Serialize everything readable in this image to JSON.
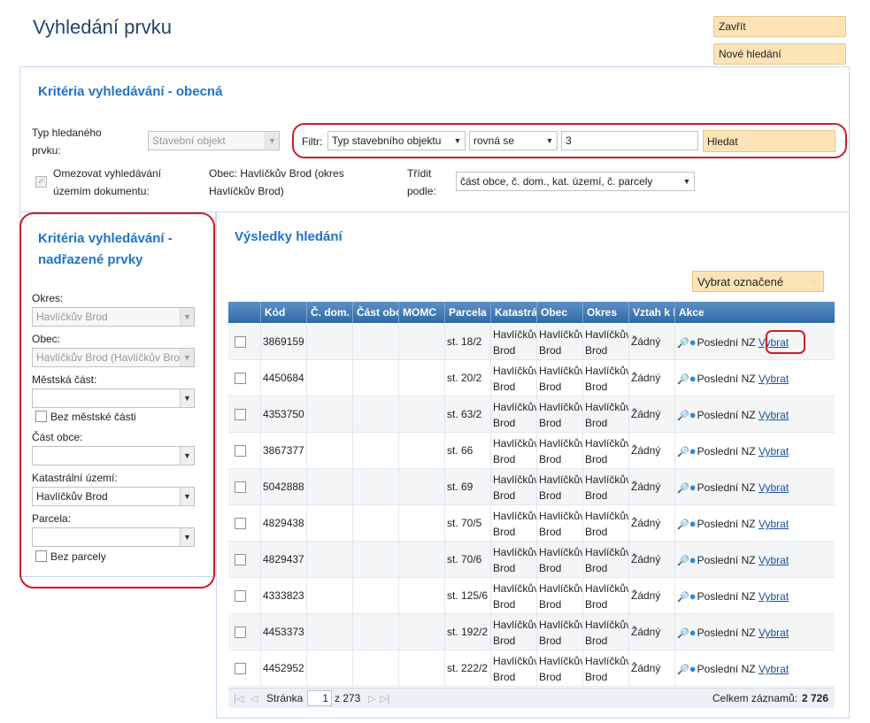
{
  "page_title": "Vyhledání prvku",
  "buttons": {
    "close": "Zavřít",
    "new_search": "Nové hledání",
    "search": "Hledat",
    "select_marked": "Vybrat označené"
  },
  "general": {
    "title": "Kritéria vyhledávání - obecná",
    "type_label": "Typ hledaného prvku:",
    "type_value": "Stavební objekt",
    "filter_label": "Filtr:",
    "filter_field": "Typ stavebního objektu",
    "filter_operator": "rovná se",
    "filter_value": "3",
    "restrict_label": "Omezovat vyhledávání územím dokumentu:",
    "obec_info": "Obec: Havlíčkův Brod (okres Havlíčkův Brod)",
    "sort_label": "Třídit podle:",
    "sort_value": "část obce, č. dom., kat. území, č. parcely"
  },
  "parent": {
    "title": "Kritéria vyhledávání - nadřazené prvky",
    "okres_label": "Okres:",
    "okres_value": "Havlíčkův Brod",
    "obec_label": "Obec:",
    "obec_value": "Havlíčkův Brod (Havlíčkův Brod)",
    "mestska_cast_label": "Městská část:",
    "mestska_cast_value": "",
    "bez_mestske_casti": "Bez městské části",
    "cast_obce_label": "Část obce:",
    "cast_obce_value": "",
    "katastralni_label": "Katastrální území:",
    "katastralni_value": "Havlíčkův Brod",
    "parcela_label": "Parcela:",
    "parcela_value": "",
    "bez_parcely": "Bez parcely"
  },
  "results": {
    "title": "Výsledky hledání",
    "columns": [
      "Kód",
      "Č. dom.",
      "Část obce",
      "MOMC",
      "Parcela",
      "Katastrální území",
      "Obec",
      "Okres",
      "Vztah k NZ",
      "Akce"
    ],
    "rows": [
      {
        "kod": "3869159",
        "parcela": "st. 18/2",
        "ku_1": "Havlíčkův",
        "ku_2": "Brod",
        "obec_1": "Havlíčkův",
        "obec_2": "Brod",
        "okres_1": "Havlíčkův",
        "okres_2": "Brod",
        "vztah": "Žádný",
        "nz": "Poslední NZ",
        "action": "Vybrat"
      },
      {
        "kod": "4450684",
        "parcela": "st. 20/2",
        "ku_1": "Havlíčkův",
        "ku_2": "Brod",
        "obec_1": "Havlíčkův",
        "obec_2": "Brod",
        "okres_1": "Havlíčkův",
        "okres_2": "Brod",
        "vztah": "Žádný",
        "nz": "Poslední NZ",
        "action": "Vybrat"
      },
      {
        "kod": "4353750",
        "parcela": "st. 63/2",
        "ku_1": "Havlíčkův",
        "ku_2": "Brod",
        "obec_1": "Havlíčkův",
        "obec_2": "Brod",
        "okres_1": "Havlíčkův",
        "okres_2": "Brod",
        "vztah": "Žádný",
        "nz": "Poslední NZ",
        "action": "Vybrat"
      },
      {
        "kod": "3867377",
        "parcela": "st. 66",
        "ku_1": "Havlíčkův",
        "ku_2": "Brod",
        "obec_1": "Havlíčkův",
        "obec_2": "Brod",
        "okres_1": "Havlíčkův",
        "okres_2": "Brod",
        "vztah": "Žádný",
        "nz": "Poslední NZ",
        "action": "Vybrat"
      },
      {
        "kod": "5042888",
        "parcela": "st. 69",
        "ku_1": "Havlíčkův",
        "ku_2": "Brod",
        "obec_1": "Havlíčkův",
        "obec_2": "Brod",
        "okres_1": "Havlíčkův",
        "okres_2": "Brod",
        "vztah": "Žádný",
        "nz": "Poslední NZ",
        "action": "Vybrat"
      },
      {
        "kod": "4829438",
        "parcela": "st. 70/5",
        "ku_1": "Havlíčkův",
        "ku_2": "Brod",
        "obec_1": "Havlíčkův",
        "obec_2": "Brod",
        "okres_1": "Havlíčkův",
        "okres_2": "Brod",
        "vztah": "Žádný",
        "nz": "Poslední NZ",
        "action": "Vybrat"
      },
      {
        "kod": "4829437",
        "parcela": "st. 70/6",
        "ku_1": "Havlíčkův",
        "ku_2": "Brod",
        "obec_1": "Havlíčkův",
        "obec_2": "Brod",
        "okres_1": "Havlíčkův",
        "okres_2": "Brod",
        "vztah": "Žádný",
        "nz": "Poslední NZ",
        "action": "Vybrat"
      },
      {
        "kod": "4333823",
        "parcela": "st. 125/6",
        "ku_1": "Havlíčkův",
        "ku_2": "Brod",
        "obec_1": "Havlíčkův",
        "obec_2": "Brod",
        "okres_1": "Havlíčkův",
        "okres_2": "Brod",
        "vztah": "Žádný",
        "nz": "Poslední NZ",
        "action": "Vybrat"
      },
      {
        "kod": "4453373",
        "parcela": "st. 192/2",
        "ku_1": "Havlíčkův",
        "ku_2": "Brod",
        "obec_1": "Havlíčkův",
        "obec_2": "Brod",
        "okres_1": "Havlíčkův",
        "okres_2": "Brod",
        "vztah": "Žádný",
        "nz": "Poslední NZ",
        "action": "Vybrat"
      },
      {
        "kod": "4452952",
        "parcela": "st. 222/2",
        "ku_1": "Havlíčkův",
        "ku_2": "Brod",
        "obec_1": "Havlíčkův",
        "obec_2": "Brod",
        "okres_1": "Havlíčkův",
        "okres_2": "Brod",
        "vztah": "Žádný",
        "nz": "Poslední NZ",
        "action": "Vybrat"
      }
    ],
    "pager": {
      "page_label": "Stránka",
      "page": "1",
      "of_pages": "z 273",
      "total_label": "Celkem záznamů:",
      "total": "2 726"
    }
  },
  "colors": {
    "accent": "#1e74c7",
    "header": "#2f6aa8",
    "button": "#fde4b6",
    "highlight": "#cc1f2b"
  }
}
